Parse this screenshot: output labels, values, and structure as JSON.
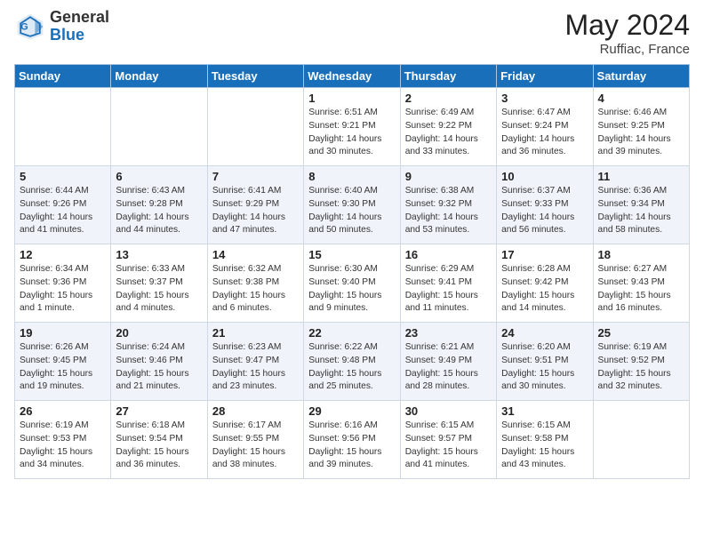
{
  "header": {
    "logo_general": "General",
    "logo_blue": "Blue",
    "month_year": "May 2024",
    "location": "Ruffiac, France"
  },
  "days_of_week": [
    "Sunday",
    "Monday",
    "Tuesday",
    "Wednesday",
    "Thursday",
    "Friday",
    "Saturday"
  ],
  "weeks": [
    [
      {
        "day": "",
        "sunrise": "",
        "sunset": "",
        "daylight": ""
      },
      {
        "day": "",
        "sunrise": "",
        "sunset": "",
        "daylight": ""
      },
      {
        "day": "",
        "sunrise": "",
        "sunset": "",
        "daylight": ""
      },
      {
        "day": "1",
        "sunrise": "Sunrise: 6:51 AM",
        "sunset": "Sunset: 9:21 PM",
        "daylight": "Daylight: 14 hours and 30 minutes."
      },
      {
        "day": "2",
        "sunrise": "Sunrise: 6:49 AM",
        "sunset": "Sunset: 9:22 PM",
        "daylight": "Daylight: 14 hours and 33 minutes."
      },
      {
        "day": "3",
        "sunrise": "Sunrise: 6:47 AM",
        "sunset": "Sunset: 9:24 PM",
        "daylight": "Daylight: 14 hours and 36 minutes."
      },
      {
        "day": "4",
        "sunrise": "Sunrise: 6:46 AM",
        "sunset": "Sunset: 9:25 PM",
        "daylight": "Daylight: 14 hours and 39 minutes."
      }
    ],
    [
      {
        "day": "5",
        "sunrise": "Sunrise: 6:44 AM",
        "sunset": "Sunset: 9:26 PM",
        "daylight": "Daylight: 14 hours and 41 minutes."
      },
      {
        "day": "6",
        "sunrise": "Sunrise: 6:43 AM",
        "sunset": "Sunset: 9:28 PM",
        "daylight": "Daylight: 14 hours and 44 minutes."
      },
      {
        "day": "7",
        "sunrise": "Sunrise: 6:41 AM",
        "sunset": "Sunset: 9:29 PM",
        "daylight": "Daylight: 14 hours and 47 minutes."
      },
      {
        "day": "8",
        "sunrise": "Sunrise: 6:40 AM",
        "sunset": "Sunset: 9:30 PM",
        "daylight": "Daylight: 14 hours and 50 minutes."
      },
      {
        "day": "9",
        "sunrise": "Sunrise: 6:38 AM",
        "sunset": "Sunset: 9:32 PM",
        "daylight": "Daylight: 14 hours and 53 minutes."
      },
      {
        "day": "10",
        "sunrise": "Sunrise: 6:37 AM",
        "sunset": "Sunset: 9:33 PM",
        "daylight": "Daylight: 14 hours and 56 minutes."
      },
      {
        "day": "11",
        "sunrise": "Sunrise: 6:36 AM",
        "sunset": "Sunset: 9:34 PM",
        "daylight": "Daylight: 14 hours and 58 minutes."
      }
    ],
    [
      {
        "day": "12",
        "sunrise": "Sunrise: 6:34 AM",
        "sunset": "Sunset: 9:36 PM",
        "daylight": "Daylight: 15 hours and 1 minute."
      },
      {
        "day": "13",
        "sunrise": "Sunrise: 6:33 AM",
        "sunset": "Sunset: 9:37 PM",
        "daylight": "Daylight: 15 hours and 4 minutes."
      },
      {
        "day": "14",
        "sunrise": "Sunrise: 6:32 AM",
        "sunset": "Sunset: 9:38 PM",
        "daylight": "Daylight: 15 hours and 6 minutes."
      },
      {
        "day": "15",
        "sunrise": "Sunrise: 6:30 AM",
        "sunset": "Sunset: 9:40 PM",
        "daylight": "Daylight: 15 hours and 9 minutes."
      },
      {
        "day": "16",
        "sunrise": "Sunrise: 6:29 AM",
        "sunset": "Sunset: 9:41 PM",
        "daylight": "Daylight: 15 hours and 11 minutes."
      },
      {
        "day": "17",
        "sunrise": "Sunrise: 6:28 AM",
        "sunset": "Sunset: 9:42 PM",
        "daylight": "Daylight: 15 hours and 14 minutes."
      },
      {
        "day": "18",
        "sunrise": "Sunrise: 6:27 AM",
        "sunset": "Sunset: 9:43 PM",
        "daylight": "Daylight: 15 hours and 16 minutes."
      }
    ],
    [
      {
        "day": "19",
        "sunrise": "Sunrise: 6:26 AM",
        "sunset": "Sunset: 9:45 PM",
        "daylight": "Daylight: 15 hours and 19 minutes."
      },
      {
        "day": "20",
        "sunrise": "Sunrise: 6:24 AM",
        "sunset": "Sunset: 9:46 PM",
        "daylight": "Daylight: 15 hours and 21 minutes."
      },
      {
        "day": "21",
        "sunrise": "Sunrise: 6:23 AM",
        "sunset": "Sunset: 9:47 PM",
        "daylight": "Daylight: 15 hours and 23 minutes."
      },
      {
        "day": "22",
        "sunrise": "Sunrise: 6:22 AM",
        "sunset": "Sunset: 9:48 PM",
        "daylight": "Daylight: 15 hours and 25 minutes."
      },
      {
        "day": "23",
        "sunrise": "Sunrise: 6:21 AM",
        "sunset": "Sunset: 9:49 PM",
        "daylight": "Daylight: 15 hours and 28 minutes."
      },
      {
        "day": "24",
        "sunrise": "Sunrise: 6:20 AM",
        "sunset": "Sunset: 9:51 PM",
        "daylight": "Daylight: 15 hours and 30 minutes."
      },
      {
        "day": "25",
        "sunrise": "Sunrise: 6:19 AM",
        "sunset": "Sunset: 9:52 PM",
        "daylight": "Daylight: 15 hours and 32 minutes."
      }
    ],
    [
      {
        "day": "26",
        "sunrise": "Sunrise: 6:19 AM",
        "sunset": "Sunset: 9:53 PM",
        "daylight": "Daylight: 15 hours and 34 minutes."
      },
      {
        "day": "27",
        "sunrise": "Sunrise: 6:18 AM",
        "sunset": "Sunset: 9:54 PM",
        "daylight": "Daylight: 15 hours and 36 minutes."
      },
      {
        "day": "28",
        "sunrise": "Sunrise: 6:17 AM",
        "sunset": "Sunset: 9:55 PM",
        "daylight": "Daylight: 15 hours and 38 minutes."
      },
      {
        "day": "29",
        "sunrise": "Sunrise: 6:16 AM",
        "sunset": "Sunset: 9:56 PM",
        "daylight": "Daylight: 15 hours and 39 minutes."
      },
      {
        "day": "30",
        "sunrise": "Sunrise: 6:15 AM",
        "sunset": "Sunset: 9:57 PM",
        "daylight": "Daylight: 15 hours and 41 minutes."
      },
      {
        "day": "31",
        "sunrise": "Sunrise: 6:15 AM",
        "sunset": "Sunset: 9:58 PM",
        "daylight": "Daylight: 15 hours and 43 minutes."
      },
      {
        "day": "",
        "sunrise": "",
        "sunset": "",
        "daylight": ""
      }
    ]
  ]
}
